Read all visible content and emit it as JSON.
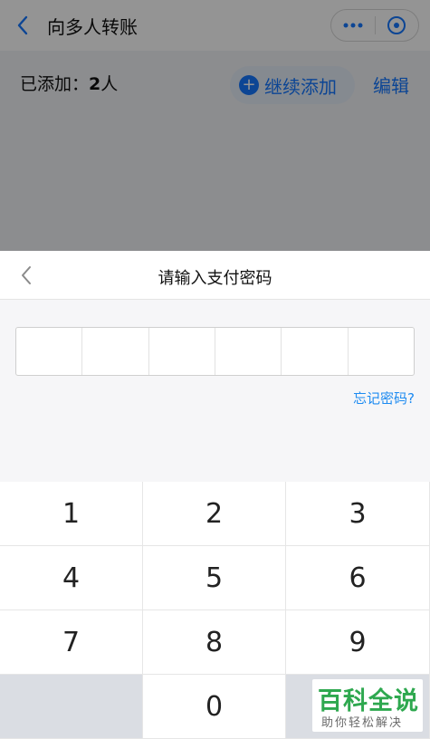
{
  "background_screen": {
    "nav_title": "向多人转账",
    "more_icon": "more-dots-icon",
    "close_icon": "mini-program-close-icon",
    "added_label": "已添加：",
    "added_count": "2",
    "added_unit": "人",
    "add_more_label": "继续添加",
    "edit_label": "编辑"
  },
  "payment_sheet": {
    "title": "请输入支付密码",
    "back_icon": "chevron-left-icon",
    "password_length": 6,
    "forgot_label": "忘记密码?"
  },
  "keypad": {
    "keys": [
      "1",
      "2",
      "3",
      "4",
      "5",
      "6",
      "7",
      "8",
      "9",
      "",
      "0",
      ""
    ]
  },
  "watermark": {
    "main": "百科全说",
    "sub": "助你轻松解决"
  },
  "colors": {
    "accent": "#1677ff",
    "link": "#1d8bf1",
    "watermark_green": "#2ea84f"
  }
}
